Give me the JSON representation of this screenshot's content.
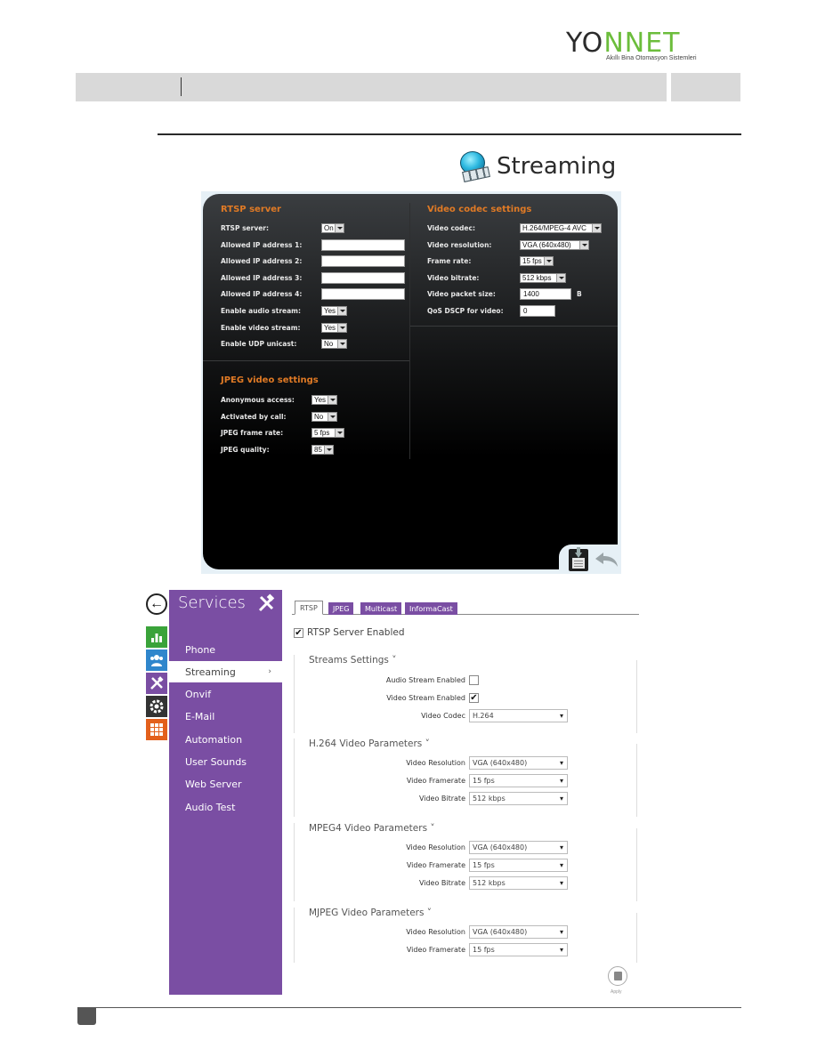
{
  "brand": {
    "logo_part1": "YO",
    "logo_part2": "NNET",
    "tagline": "Akıllı Bina Otomasyon Sistemleri"
  },
  "section_heading": "Streaming",
  "legacy_ui": {
    "rtsp": {
      "title": "RTSP server",
      "fields": [
        {
          "label": "RTSP server:",
          "type": "select",
          "value": "On"
        },
        {
          "label": "Allowed IP address 1:",
          "type": "input",
          "value": ""
        },
        {
          "label": "Allowed IP address 2:",
          "type": "input",
          "value": ""
        },
        {
          "label": "Allowed IP address 3:",
          "type": "input",
          "value": ""
        },
        {
          "label": "Allowed IP address 4:",
          "type": "input",
          "value": ""
        },
        {
          "label": "Enable audio stream:",
          "type": "select",
          "value": "Yes"
        },
        {
          "label": "Enable video stream:",
          "type": "select",
          "value": "Yes"
        },
        {
          "label": "Enable UDP unicast:",
          "type": "select",
          "value": "No"
        }
      ]
    },
    "jpeg": {
      "title": "JPEG video settings",
      "fields": [
        {
          "label": "Anonymous access:",
          "type": "select",
          "value": "Yes"
        },
        {
          "label": "Activated by call:",
          "type": "select",
          "value": "No"
        },
        {
          "label": "JPEG frame rate:",
          "type": "select",
          "value": "5 fps"
        },
        {
          "label": "JPEG quality:",
          "type": "select",
          "value": "85"
        }
      ]
    },
    "codec": {
      "title": "Video codec settings",
      "fields": [
        {
          "label": "Video codec:",
          "type": "select",
          "value": "H.264/MPEG-4 AVC"
        },
        {
          "label": "Video resolution:",
          "type": "select",
          "value": "VGA (640x480)"
        },
        {
          "label": "Frame rate:",
          "type": "select",
          "value": "15 fps"
        },
        {
          "label": "Video bitrate:",
          "type": "select",
          "value": "512 kbps"
        },
        {
          "label": "Video packet size:",
          "type": "input",
          "value": "1400",
          "unit": "B"
        },
        {
          "label": "QoS DSCP for video:",
          "type": "input",
          "value": "0"
        }
      ]
    }
  },
  "new_ui": {
    "sidebar": {
      "title": "Services",
      "items": [
        "Phone",
        "Streaming",
        "Onvif",
        "E-Mail",
        "Automation",
        "User Sounds",
        "Web Server",
        "Audio Test"
      ],
      "active": "Streaming",
      "active_chevron": "›"
    },
    "tabs": [
      "RTSP",
      "JPEG",
      "Multicast",
      "InformaCast"
    ],
    "active_tab": "RTSP",
    "rtsp_enabled_label": "RTSP Server Enabled",
    "rtsp_enabled": true,
    "streams_settings": {
      "title": "Streams Settings ˅",
      "audio_label": "Audio Stream Enabled",
      "audio_checked": false,
      "video_label": "Video Stream Enabled",
      "video_checked": true,
      "codec_label": "Video Codec",
      "codec_value": "H.264"
    },
    "h264": {
      "title": "H.264 Video Parameters ˅",
      "fields": [
        {
          "label": "Video Resolution",
          "value": "VGA (640x480)"
        },
        {
          "label": "Video Framerate",
          "value": "15 fps"
        },
        {
          "label": "Video Bitrate",
          "value": "512 kbps"
        }
      ]
    },
    "mpeg4": {
      "title": "MPEG4 Video Parameters ˅",
      "fields": [
        {
          "label": "Video Resolution",
          "value": "VGA (640x480)"
        },
        {
          "label": "Video Framerate",
          "value": "15 fps"
        },
        {
          "label": "Video Bitrate",
          "value": "512 kbps"
        }
      ]
    },
    "mjpeg": {
      "title": "MJPEG Video Parameters ˅",
      "fields": [
        {
          "label": "Video Resolution",
          "value": "VGA (640x480)"
        },
        {
          "label": "Video Framerate",
          "value": "15 fps"
        }
      ]
    },
    "apply_label": "Apply",
    "back_glyph": "←"
  }
}
